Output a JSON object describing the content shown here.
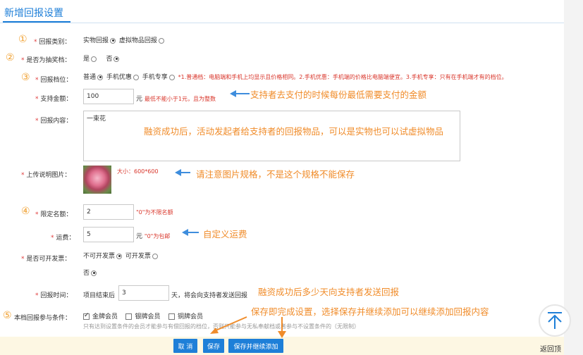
{
  "header": {
    "title": "新增回报设置"
  },
  "nums": [
    "①",
    "②",
    "③",
    "④",
    "⑤"
  ],
  "fields": {
    "type": {
      "label": "回报类别：",
      "opt1": "实物回报",
      "opt2": "虚拟物品回报"
    },
    "lottery": {
      "label": "是否为抽奖档：",
      "opt1": "是",
      "opt2": "否"
    },
    "tier": {
      "label": "回报档位：",
      "opt1": "普通",
      "opt2": "手机优惠",
      "opt3": "手机专享",
      "hint": "*1.普通档：电脑端和手机上均显示且价格相同。2.手机优惠：手机端的价格比电脑端便宜。3.手机专享：只有在手机端才有的档位。"
    },
    "amount": {
      "label": "支持金额：",
      "value": "100",
      "unit": "元",
      "hint": "最低不能小于1元，且为整数"
    },
    "content": {
      "label": "回报内容：",
      "value": "一束花"
    },
    "image": {
      "label": "上传说明图片：",
      "size": "大小：600*600"
    },
    "quota": {
      "label": "限定名额：",
      "value": "2",
      "hint": "\"0\"为不限名额"
    },
    "shipping": {
      "label": "运费：",
      "value": "5",
      "unit": "元",
      "hint": "\"0\"为包邮"
    },
    "invoice": {
      "label": "是否可开发票：",
      "opt1": "不可开发票",
      "opt2": "可开发票",
      "opt3": "否"
    },
    "time": {
      "label": "回报时间：",
      "prefix": "项目结束后",
      "value": "3",
      "suffix": "天，将会向支持者发送回报"
    },
    "members": {
      "label": "本档回报参与条件：",
      "opt1": "金牌会员",
      "opt2": "银牌会员",
      "opt3": "铜牌会员",
      "note": "只有达到设置条件的会员才能参与有偿回报的档位，否则只能参与无私奉献档或者参与不设置条件的（无限制）"
    }
  },
  "annotations": {
    "amount": "支持者去支付的时候每份最低需要支付的金额",
    "content": "融资成功后，活动发起者给支持者的回报物品，可以是实物也可以试虚拟物品",
    "image": "请注意图片规格，不是这个规格不能保存",
    "shipping": "自定义运费",
    "time": "融资成功后多少天向支持者发送回报",
    "save": "保存即完成设置，选择保存并继续添加可以继续添加回报内容"
  },
  "buttons": {
    "cancel": "取 消",
    "save": "保存",
    "save_continue": "保存并继续添加"
  },
  "back_to_top": "返回顶"
}
